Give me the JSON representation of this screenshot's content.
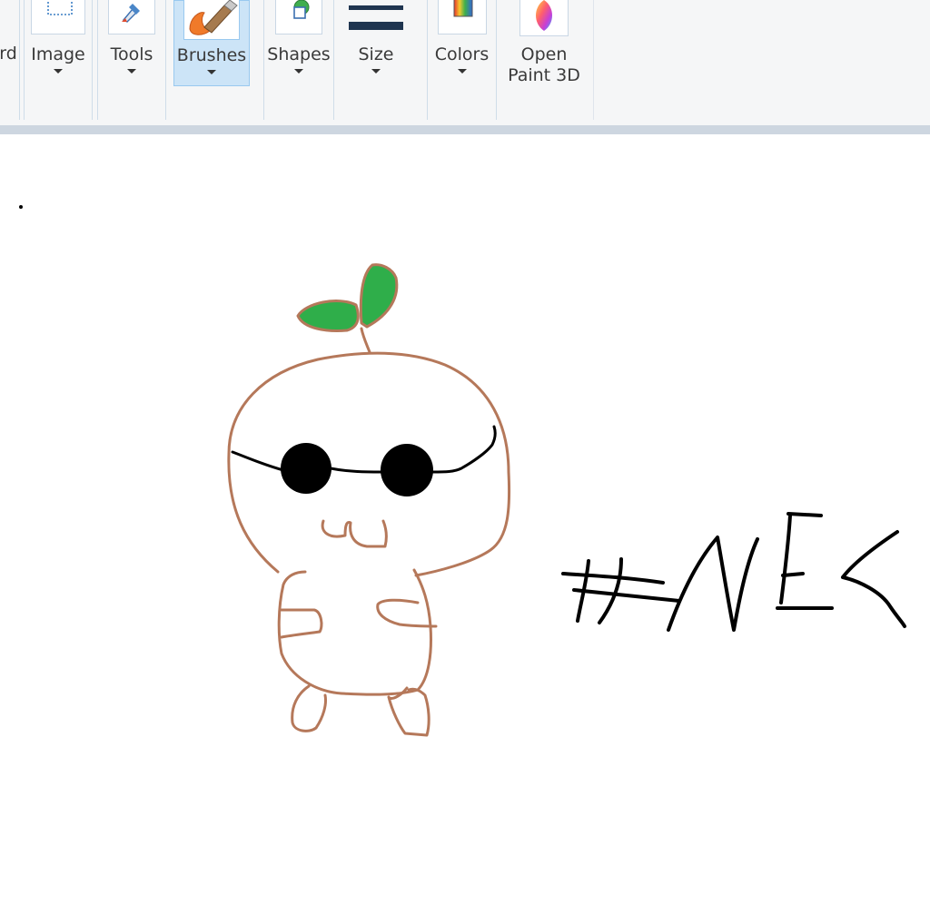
{
  "ribbon": {
    "clipboard_fragment": "rd",
    "image": {
      "label": "Image",
      "icon": "select-icon"
    },
    "tools": {
      "label": "Tools",
      "icon": "tools-icon"
    },
    "brushes": {
      "label": "Brushes",
      "icon": "brush-icon",
      "selected": true
    },
    "shapes": {
      "label": "Shapes",
      "icon": "shapes-icon"
    },
    "size": {
      "label": "Size",
      "icon": "line-size-icon"
    },
    "colors": {
      "label": "Colors",
      "icon": "color-palette-icon"
    },
    "paint3d": {
      "label_line1": "Open",
      "label_line2": "Paint 3D",
      "icon": "paint3d-icon"
    }
  },
  "canvas": {
    "drawing": "hand-drawn sprout character with sunglasses",
    "handwritten_text": "#NEK",
    "colors": {
      "outline": "#b5785a",
      "leaf": "#2fae4a",
      "ink": "#000000",
      "ribbon_selected": "#cce4f7"
    }
  }
}
